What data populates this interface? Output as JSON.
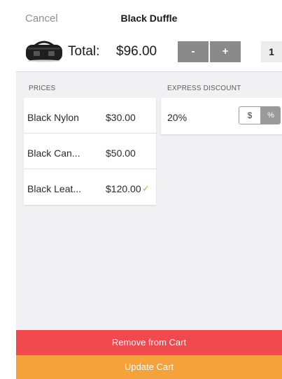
{
  "header": {
    "cancel_label": "Cancel",
    "title": "Black Duffle"
  },
  "total_bar": {
    "label": "Total:",
    "value": "$96.00",
    "minus_label": "-",
    "plus_label": "+",
    "quantity": "1",
    "product_image_icon": "duffle-bag-icon"
  },
  "prices": {
    "heading": "PRICES",
    "items": [
      {
        "name": "Black Nylon",
        "price": "$30.00",
        "selected": false
      },
      {
        "name": "Black Can...",
        "price": "$50.00",
        "selected": false
      },
      {
        "name": "Black Leat...",
        "price": "$120.00",
        "selected": true
      }
    ],
    "check_glyph": "✓"
  },
  "discount": {
    "heading": "EXPRESS DISCOUNT",
    "value": "20%",
    "dollar_label": "$",
    "percent_label": "%",
    "selected_mode": "percent"
  },
  "actions": {
    "remove_label": "Remove from Cart",
    "update_label": "Update Cart"
  },
  "colors": {
    "remove": "#f04a4f",
    "update": "#f5a23a",
    "check": "#f0a52a",
    "stepper": "#8a8a8a"
  }
}
